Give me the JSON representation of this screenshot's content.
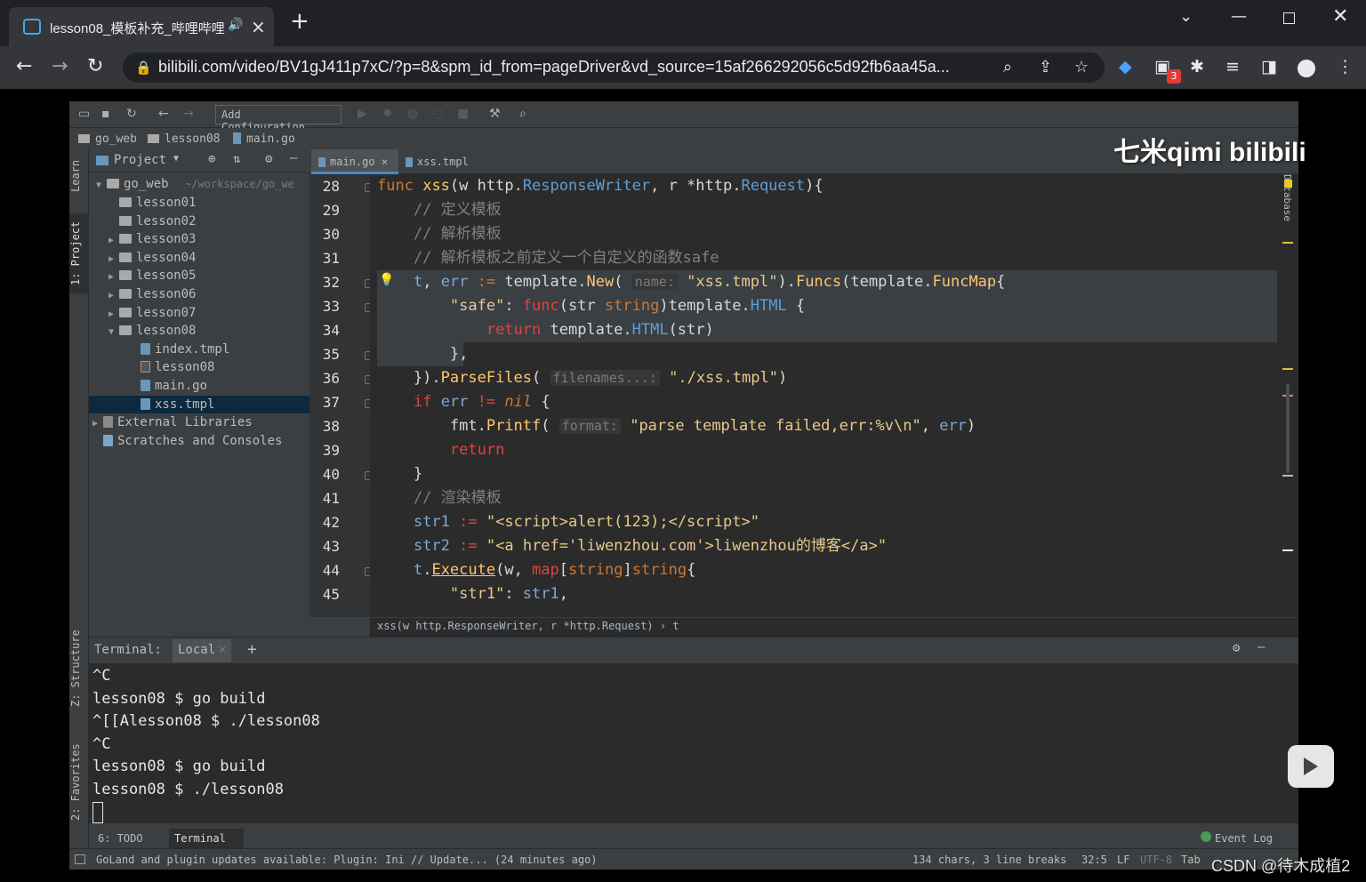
{
  "browser": {
    "tab_title": "lesson08_模板补充_哔哩哔哩",
    "url": "bilibili.com/video/BV1gJ411p7xC/?p=8&spm_id_from=pageDriver&vd_source=15af266292056c5d92fb6aa45a...",
    "extension_badge": "3"
  },
  "ide": {
    "add_configuration": "Add Configuration...",
    "breadcrumb": [
      "go_web",
      "lesson08",
      "main.go"
    ],
    "side_tabs": {
      "learn": "Learn",
      "project": "1: Project",
      "structure": "Z: Structure",
      "favorites": "2: Favorites",
      "database": "Database"
    },
    "project": {
      "header": "Project",
      "root": "go_web",
      "root_path": "~/workspace/go_we",
      "items": [
        {
          "label": "lesson01",
          "kind": "folder",
          "depth": 1,
          "arrow": ""
        },
        {
          "label": "lesson02",
          "kind": "folder",
          "depth": 1,
          "arrow": ""
        },
        {
          "label": "lesson03",
          "kind": "folder",
          "depth": 1,
          "arrow": "▶"
        },
        {
          "label": "lesson04",
          "kind": "folder",
          "depth": 1,
          "arrow": "▶"
        },
        {
          "label": "lesson05",
          "kind": "folder",
          "depth": 1,
          "arrow": "▶"
        },
        {
          "label": "lesson06",
          "kind": "folder",
          "depth": 1,
          "arrow": "▶"
        },
        {
          "label": "lesson07",
          "kind": "folder",
          "depth": 1,
          "arrow": "▶"
        },
        {
          "label": "lesson08",
          "kind": "folder",
          "depth": 1,
          "arrow": "▼"
        },
        {
          "label": "index.tmpl",
          "kind": "file",
          "depth": 2,
          "arrow": ""
        },
        {
          "label": "lesson08",
          "kind": "bin",
          "depth": 2,
          "arrow": ""
        },
        {
          "label": "main.go",
          "kind": "file",
          "depth": 2,
          "arrow": ""
        },
        {
          "label": "xss.tmpl",
          "kind": "file",
          "depth": 2,
          "arrow": "",
          "selected": true
        },
        {
          "label": "External Libraries",
          "kind": "lib",
          "depth": 0,
          "arrow": "▶"
        },
        {
          "label": "Scratches and Consoles",
          "kind": "scratch",
          "depth": 0,
          "arrow": ""
        }
      ]
    },
    "editor_tabs": [
      "main.go",
      "xss.tmpl"
    ],
    "line_numbers": [
      "28",
      "29",
      "30",
      "31",
      "32",
      "33",
      "34",
      "35",
      "36",
      "37",
      "38",
      "39",
      "40",
      "41",
      "42",
      "43",
      "44",
      "45"
    ],
    "code_breadcrumb": "xss(w http.ResponseWriter, r *http.Request) › t",
    "terminal": {
      "label": "Terminal:",
      "tab": "Local",
      "lines": [
        "^C",
        "lesson08 $ go build",
        "^[[Alesson08 $ ./lesson08",
        "^C",
        "lesson08 $ go build",
        "lesson08 $ ./lesson08"
      ]
    },
    "bottom_tabs": {
      "todo": "6: TODO",
      "terminal": "Terminal",
      "event_log": "Event Log"
    },
    "status": {
      "message": "GoLand and plugin updates available: Plugin: Ini // Update... (24 minutes ago)",
      "chars": "134 chars, 3 line breaks",
      "position": "32:5",
      "line_sep": "LF",
      "encoding": "UTF-8",
      "indent": "Tab"
    }
  },
  "overlay": {
    "watermark": "七米qimi bilibili",
    "csdn": "CSDN @待木成植2"
  },
  "colors": {
    "ide_bg": "#3c3f41",
    "editor_bg": "#2b2b2b",
    "keyword": "#cc7832",
    "function": "#ffc66d"
  }
}
